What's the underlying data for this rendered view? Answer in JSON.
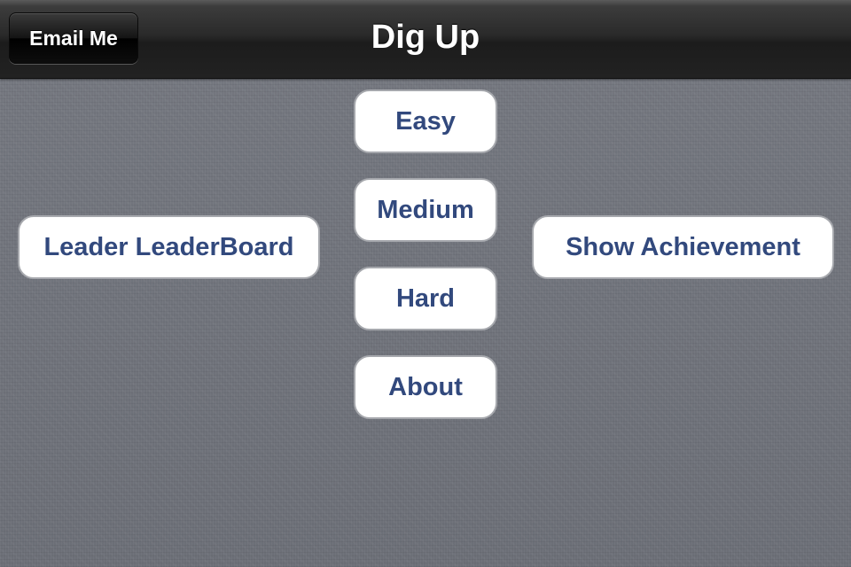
{
  "nav_bar": {
    "title": "Dig Up",
    "left_button_label": "Email Me"
  },
  "menu": {
    "difficulty": {
      "easy_label": "Easy",
      "medium_label": "Medium",
      "hard_label": "Hard"
    },
    "about_label": "About",
    "leaderboard_label": "Leader LeaderBoard",
    "achievement_label": "Show Achievement"
  },
  "colors": {
    "nav_bar": "#1c1c1c",
    "background": "#6f727a",
    "button_background": "#ffffff",
    "button_text": "#32497d",
    "button_border": "#a6a8ad"
  }
}
